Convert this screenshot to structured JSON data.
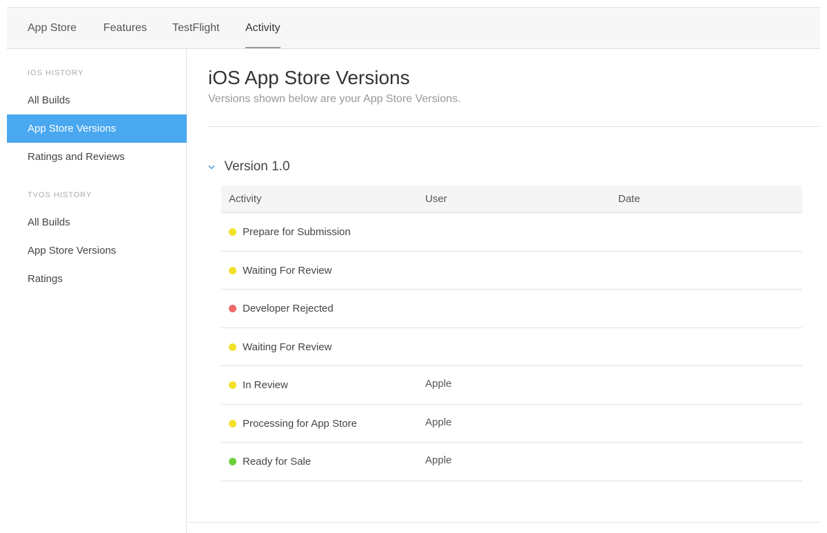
{
  "topnav": {
    "tabs": [
      {
        "label": "App Store",
        "active": false
      },
      {
        "label": "Features",
        "active": false
      },
      {
        "label": "TestFlight",
        "active": false
      },
      {
        "label": "Activity",
        "active": true
      }
    ]
  },
  "sidebar": {
    "ios_heading": "iOS HISTORY",
    "ios_items": [
      {
        "label": "All Builds",
        "active": false
      },
      {
        "label": "App Store Versions",
        "active": true
      },
      {
        "label": "Ratings and Reviews",
        "active": false
      }
    ],
    "tvos_heading": "tvOS HISTORY",
    "tvos_items": [
      {
        "label": "All Builds",
        "active": false
      },
      {
        "label": "App Store Versions",
        "active": false
      },
      {
        "label": "Ratings",
        "active": false
      }
    ]
  },
  "main": {
    "title": "iOS App Store Versions",
    "subtitle": "Versions shown below are your App Store Versions.",
    "version": {
      "label": "Version 1.0",
      "expanded": true,
      "chevron_icon": "chevron-down-icon"
    },
    "table": {
      "columns": [
        "Activity",
        "User",
        "Date"
      ],
      "rows": [
        {
          "activity": "Prepare for Submission",
          "status_color": "#f2e12a",
          "user": "",
          "date": ""
        },
        {
          "activity": "Waiting For Review",
          "status_color": "#f2e12a",
          "user": "",
          "date": ""
        },
        {
          "activity": "Developer Rejected",
          "status_color": "#ef6a6a",
          "user": "",
          "date": ""
        },
        {
          "activity": "Waiting For Review",
          "status_color": "#f2e12a",
          "user": "",
          "date": ""
        },
        {
          "activity": "In Review",
          "status_color": "#f2e12a",
          "user": "Apple",
          "date": ""
        },
        {
          "activity": "Processing for App Store",
          "status_color": "#f2e12a",
          "user": "Apple",
          "date": ""
        },
        {
          "activity": "Ready for Sale",
          "status_color": "#6fcf3a",
          "user": "Apple",
          "date": ""
        }
      ]
    }
  },
  "colors": {
    "accent": "#4aa8f0",
    "chevron": "#3a8fd8"
  }
}
